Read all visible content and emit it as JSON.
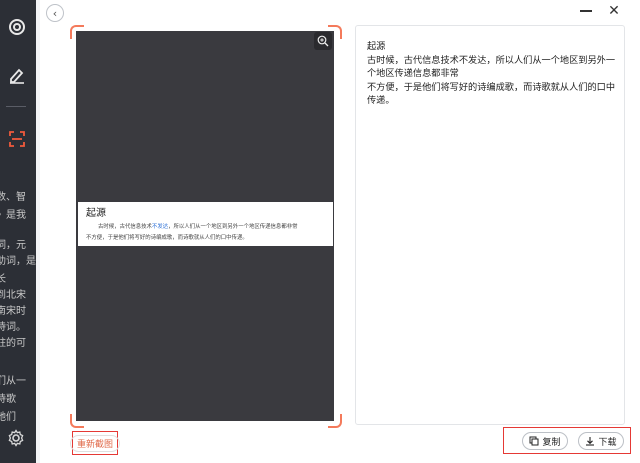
{
  "rail": {
    "icons": [
      "target-icon",
      "edit-icon",
      "scan-icon",
      "settings-icon"
    ]
  },
  "ghost_text": [
    "数、智",
    "》是我",
    "词，元",
    "助词，是",
    "长",
    "到北宋",
    "南宋时",
    "诗词。",
    "柱的可",
    "们从一",
    "诗歌",
    "她们"
  ],
  "dialog": {
    "back_label": "‹",
    "close_label": "✕"
  },
  "preview": {
    "snippet_title": "起源",
    "snippet_line1_a": "古时候，古代信息技术",
    "snippet_line1_hl": "不发达",
    "snippet_line1_b": "，所以人们从一个地区到另外一个地区传递信息都非常",
    "snippet_line2": "不方便，于是他们将写好的诗编成歌，而诗歌就从人们的口中传递。"
  },
  "result": {
    "lines": [
      "起源",
      "古时候，古代信息技术不发达，所以人们从一个地区到另外一",
      "个地区传递信息都非常",
      "不方便，于是他们将写好的诗编成歌，而诗歌就从人们的口中",
      "传递。"
    ]
  },
  "buttons": {
    "rescan": "重新截图",
    "copy": "复制",
    "download": "下载"
  },
  "colors": {
    "accent": "#f47a5b",
    "highlight_box": "#e53935",
    "rail": "#2c2f36",
    "preview_bg": "#3a3a3f"
  }
}
